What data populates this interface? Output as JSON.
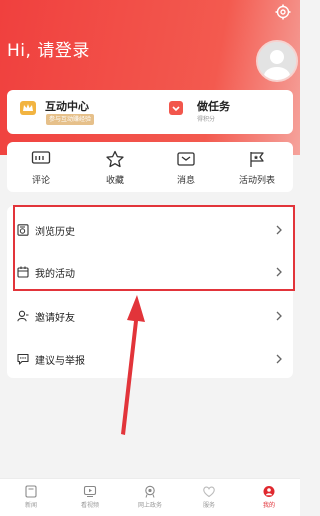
{
  "header": {
    "greeting": "Hi, 请登录",
    "settings_icon": "gear-icon",
    "avatar_icon": "user-avatar-icon"
  },
  "promo": {
    "interaction_center": {
      "title": "互动中心",
      "badge": "参与互动赚经验",
      "icon": "crown-icon"
    },
    "tasks": {
      "title": "做任务",
      "subtitle": "得积分",
      "icon": "task-bag-icon"
    }
  },
  "quick_actions": [
    {
      "label": "评论",
      "icon": "comment-icon"
    },
    {
      "label": "收藏",
      "icon": "star-icon"
    },
    {
      "label": "消息",
      "icon": "message-icon"
    },
    {
      "label": "活动列表",
      "icon": "flag-icon"
    }
  ],
  "menu": [
    {
      "label": "浏览历史",
      "icon": "history-icon"
    },
    {
      "label": "我的活动",
      "icon": "calendar-icon"
    },
    {
      "label": "邀请好友",
      "icon": "invite-friend-icon"
    },
    {
      "label": "建议与举报",
      "icon": "feedback-icon"
    }
  ],
  "annotation": {
    "color": "#e2343a"
  },
  "tabs": [
    {
      "label": "新闻",
      "icon": "news-icon",
      "active": false
    },
    {
      "label": "看视频",
      "icon": "video-icon",
      "active": false
    },
    {
      "label": "网上政务",
      "icon": "government-icon",
      "active": false
    },
    {
      "label": "服务",
      "icon": "heart-service-icon",
      "active": false
    },
    {
      "label": "我的",
      "icon": "profile-icon",
      "active": true
    }
  ],
  "colors": {
    "brand": "#f0403e",
    "active_tab": "#e0282e",
    "badge": "#e6c08a"
  }
}
